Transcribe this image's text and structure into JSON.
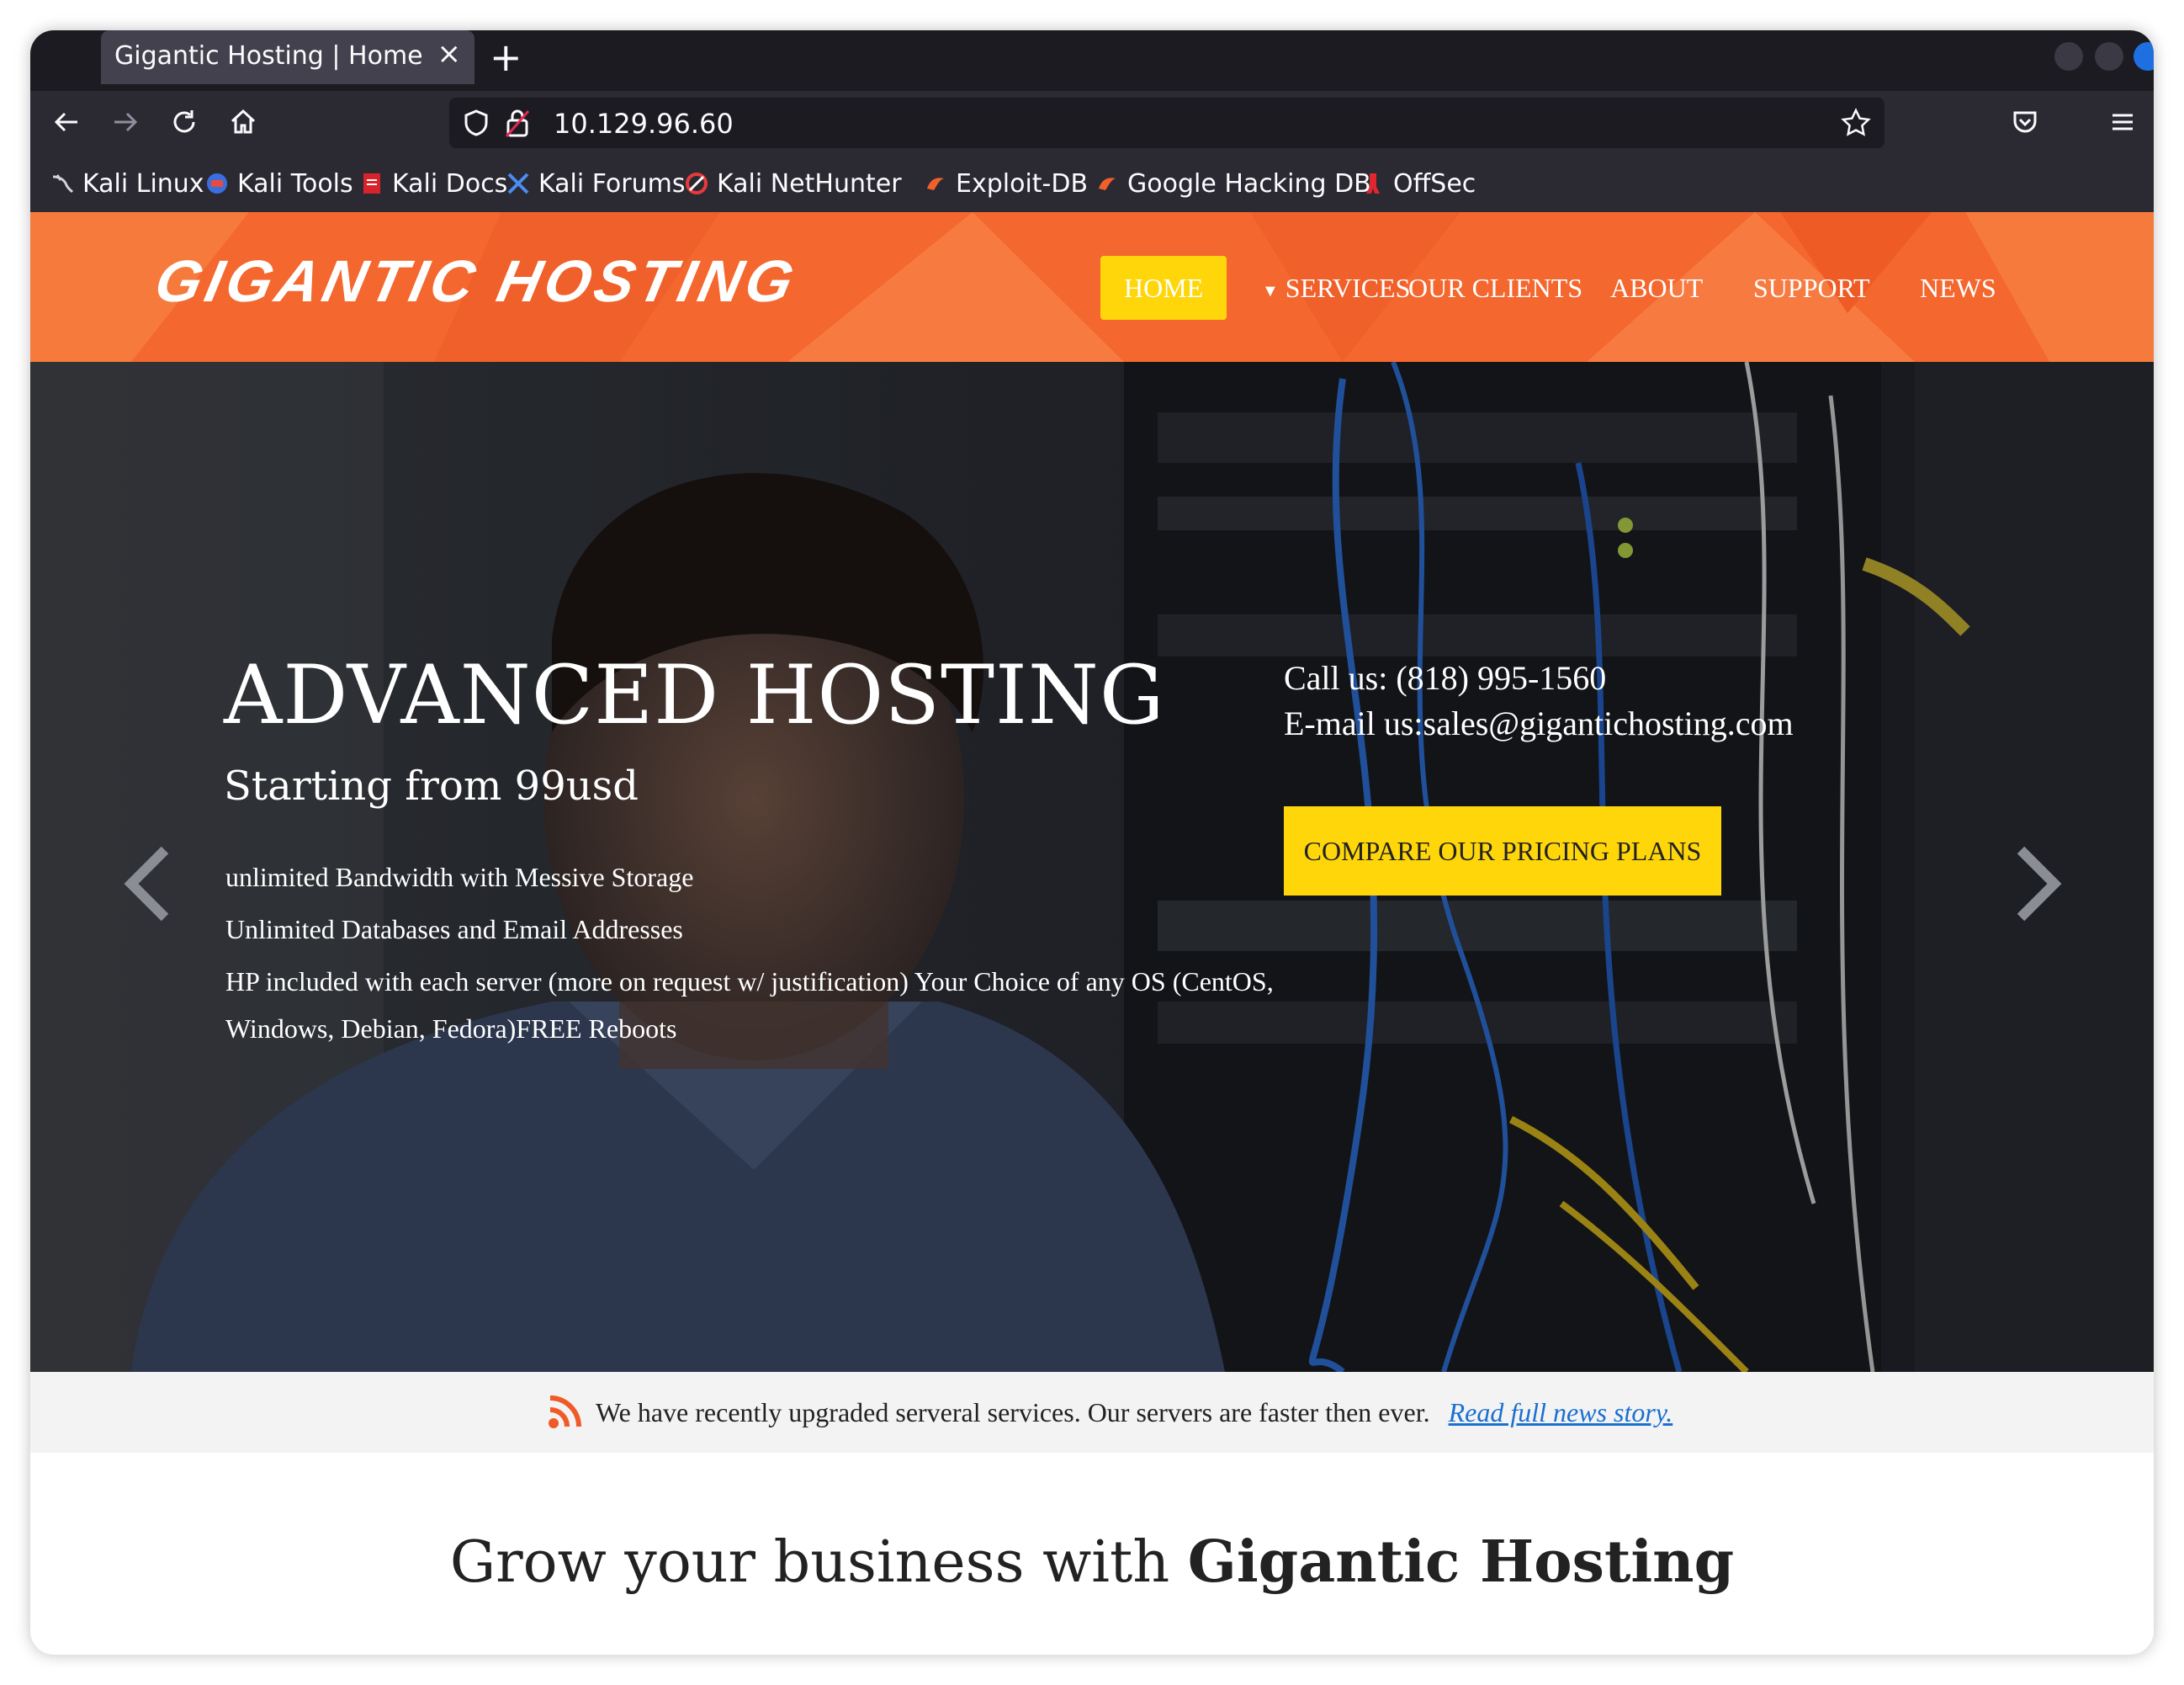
{
  "browser": {
    "tab_title": "Gigantic Hosting | Home",
    "tab_close": "×",
    "new_tab": "+",
    "url": "10.129.96.60",
    "bookmarks": [
      {
        "label": "Kali Linux",
        "icon": "kali-dragon-icon"
      },
      {
        "label": "Kali Tools",
        "icon": "kali-tools-icon"
      },
      {
        "label": "Kali Docs",
        "icon": "kali-docs-icon"
      },
      {
        "label": "Kali Forums",
        "icon": "kali-forums-icon"
      },
      {
        "label": "Kali NetHunter",
        "icon": "nethunter-icon"
      },
      {
        "label": "Exploit-DB",
        "icon": "exploit-db-icon"
      },
      {
        "label": "Google Hacking DB",
        "icon": "ghdb-icon"
      },
      {
        "label": "OffSec",
        "icon": "offsec-icon"
      }
    ]
  },
  "site": {
    "logo": "GIGANTIC HOSTING",
    "menu": {
      "home": "HOME",
      "services": "SERVICES",
      "clients": "OUR CLIENTS",
      "about": "ABOUT",
      "support": "SUPPORT",
      "news": "NEWS"
    },
    "hero": {
      "title": "ADVANCED HOSTING",
      "subtitle": "Starting from 99usd",
      "lines": [
        "unlimited Bandwidth with Messive Storage",
        "Unlimited Databases and Email Addresses",
        "HP included with each server (more on request w/ justification) Your Choice of any OS (CentOS,",
        "Windows, Debian, Fedora)FREE Reboots"
      ],
      "call_label": "Call us: ",
      "phone": "(818) 995-1560",
      "email_label": "E-mail us:",
      "email": "sales@gigantichosting.com",
      "cta": "COMPARE OUR PRICING PLANS"
    },
    "news": {
      "text": "We have recently upgraded serveral services. Our servers are faster then ever.",
      "link": "Read full news story."
    },
    "grow": {
      "prefix": "Grow your business with ",
      "brand": "Gigantic Hosting"
    }
  },
  "colors": {
    "header_orange": "#f4672e",
    "accent_yellow": "#ffd60a",
    "chrome_dark": "#1c1b22",
    "link_blue": "#1a6fd1"
  }
}
